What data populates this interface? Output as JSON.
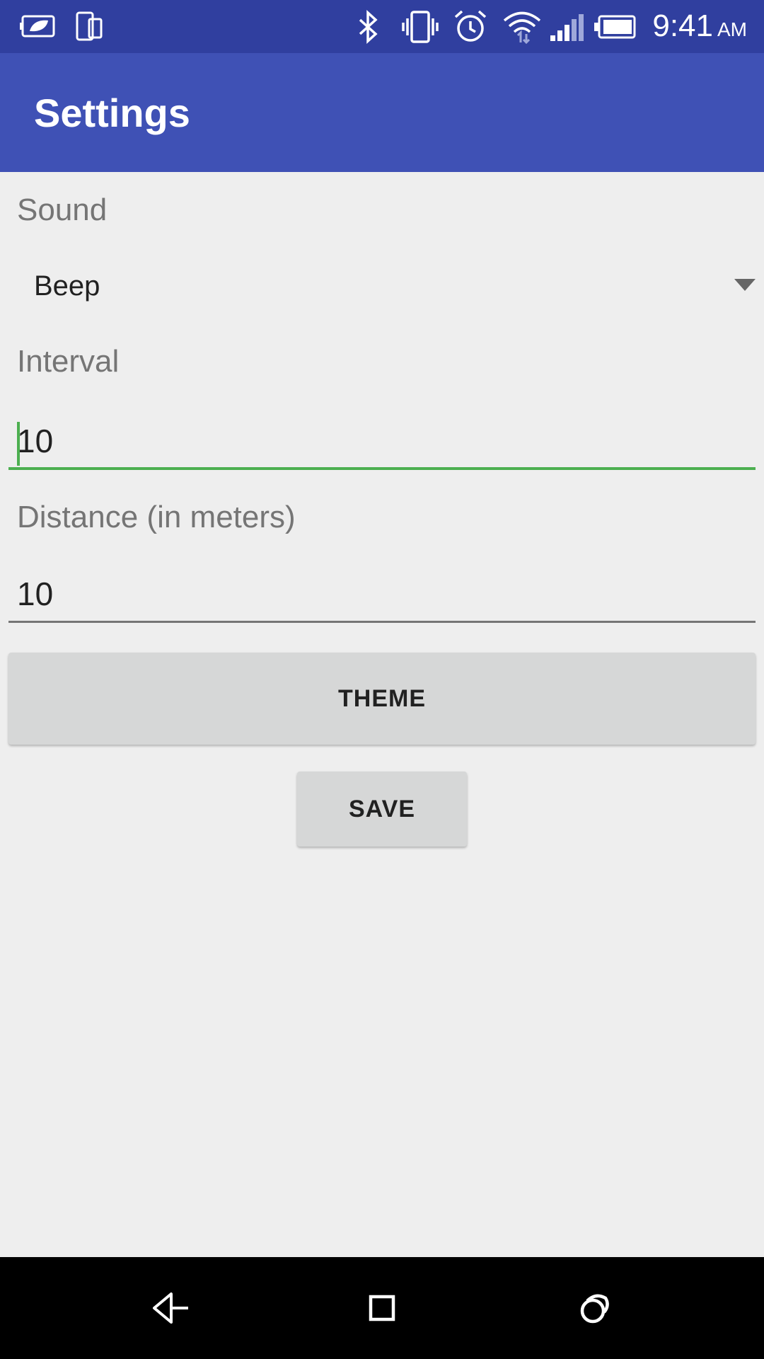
{
  "status_bar": {
    "time": "9:41",
    "ampm": "AM",
    "icons": [
      "battery-saver-icon",
      "device-icon",
      "bluetooth-icon",
      "vibrate-icon",
      "alarm-icon",
      "wifi-icon",
      "signal-icon",
      "battery-icon"
    ]
  },
  "app_bar": {
    "title": "Settings"
  },
  "sound": {
    "label": "Sound",
    "selected": "Beep"
  },
  "interval": {
    "label": "Interval",
    "value": "10"
  },
  "distance": {
    "label": "Distance (in meters)",
    "value": "10"
  },
  "buttons": {
    "theme": "THEME",
    "save": "SAVE"
  },
  "nav_bar": {
    "icons": [
      "back-icon",
      "home-icon",
      "recents-icon"
    ]
  },
  "colors": {
    "status_bar": "#303f9f",
    "app_bar": "#3f51b5",
    "background": "#eeeeee",
    "focus_accent": "#4caf50",
    "button": "#d6d7d7"
  }
}
